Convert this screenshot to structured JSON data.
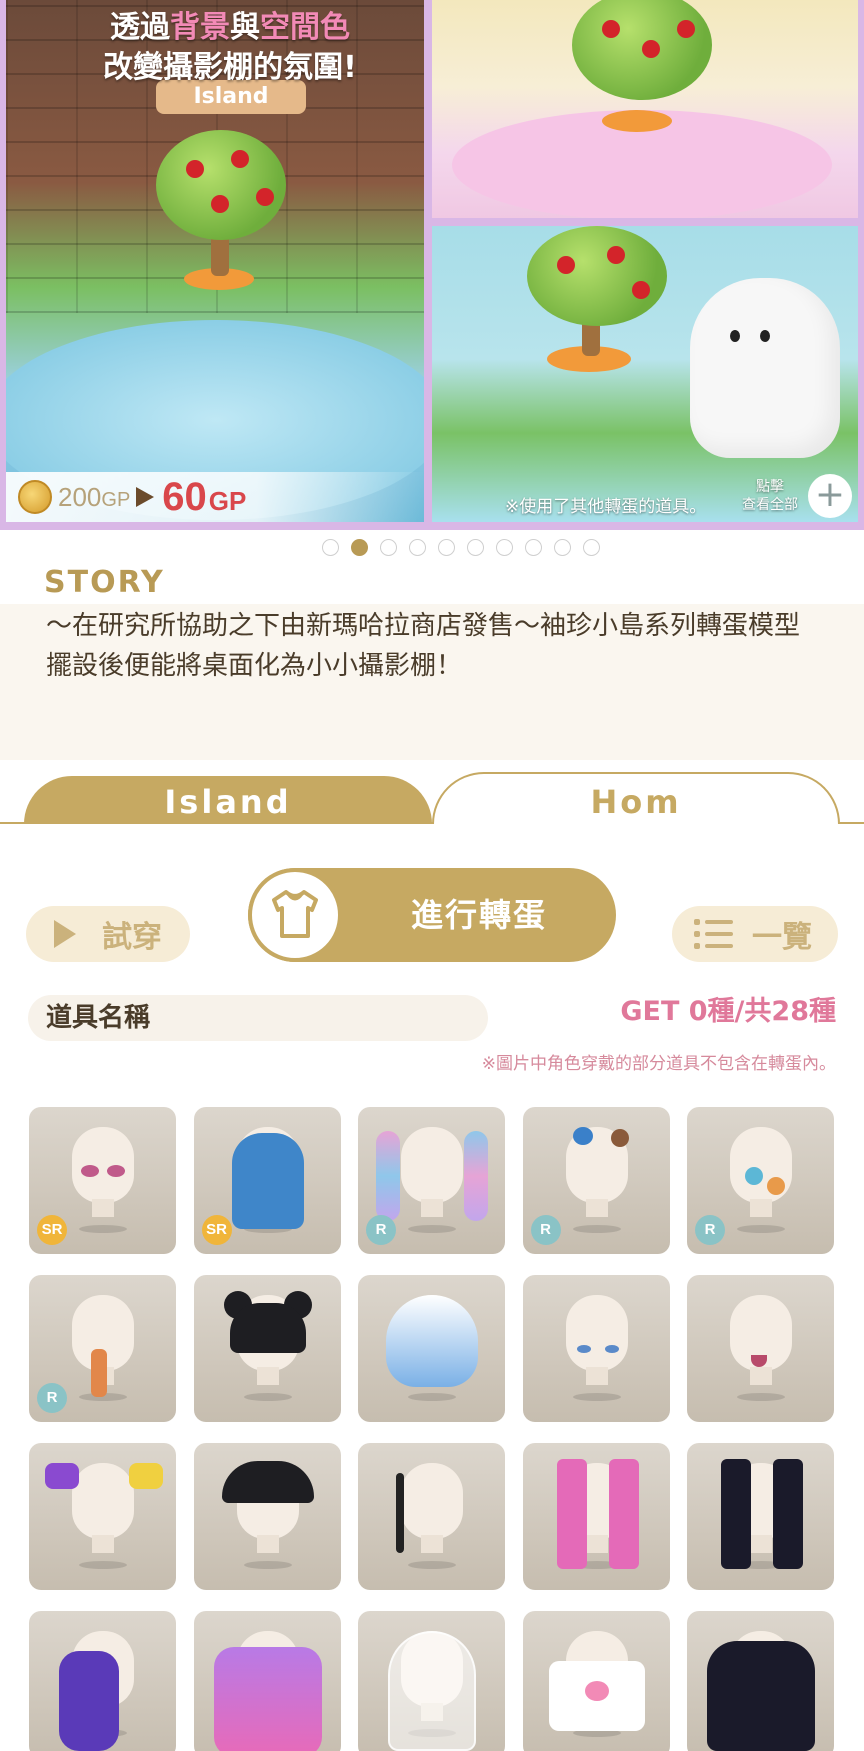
{
  "banner": {
    "headline_part1": "透過",
    "headline_hl1": "背景",
    "headline_part2": "與",
    "headline_hl2": "空間色",
    "headline_line2": "改變攝影棚的氛圍!",
    "sign_text": "Island",
    "price_old": "200",
    "price_old_unit": "GP",
    "price_new": "60",
    "price_new_unit": "GP",
    "note": "※使用了其他轉蛋的道具。",
    "tap_label": "點擊",
    "view_all_label": "查看全部",
    "plus_icon": "+"
  },
  "carousel": {
    "total": 10,
    "active_index": 1
  },
  "story": {
    "title": "STORY",
    "text": "～在研究所協助之下由新瑪哈拉商店發售～袖珍小島系列轉蛋模型 擺設後便能將桌面化為小小攝影棚！"
  },
  "tabs": [
    {
      "label": "Island",
      "active": true
    },
    {
      "label": "Hom",
      "active": false
    }
  ],
  "actions": {
    "try_on_label": "試穿",
    "gacha_label": "進行轉蛋",
    "list_label": "一覽"
  },
  "item_name_label": "道具名稱",
  "count_text": "GET 0種/共28種",
  "disclaimer": "※圖片中角色穿戴的部分道具不包含在轉蛋內。",
  "colors": {
    "gold": "#c6a962",
    "pink": "#e0789a",
    "sr_badge": "#f0b53a",
    "r_badge": "#8ac3c6"
  },
  "items": [
    {
      "name": "eyes-pink",
      "rarity": "SR"
    },
    {
      "name": "hair-long-blue",
      "rarity": "SR"
    },
    {
      "name": "hair-rainbow-braids",
      "rarity": "R"
    },
    {
      "name": "hair-accessory-animals",
      "rarity": "R"
    },
    {
      "name": "badge-pins",
      "rarity": "R"
    },
    {
      "name": "mini-figure",
      "rarity": "R"
    },
    {
      "name": "hair-black-buns",
      "rarity": ""
    },
    {
      "name": "hair-white-blue-bob",
      "rarity": ""
    },
    {
      "name": "eyes-blue",
      "rarity": ""
    },
    {
      "name": "mouth-open",
      "rarity": ""
    },
    {
      "name": "ribbon-purple-yellow",
      "rarity": ""
    },
    {
      "name": "cap-black-badges",
      "rarity": ""
    },
    {
      "name": "phone-strap",
      "rarity": ""
    },
    {
      "name": "leg-warmers-pink",
      "rarity": ""
    },
    {
      "name": "leg-warmers-black",
      "rarity": ""
    },
    {
      "name": "backpack-purple",
      "rarity": ""
    },
    {
      "name": "jacket-purple",
      "rarity": ""
    },
    {
      "name": "glass-dome",
      "rarity": ""
    },
    {
      "name": "tshirt-rainbow-heart",
      "rarity": ""
    },
    {
      "name": "hoodie-black",
      "rarity": ""
    }
  ]
}
